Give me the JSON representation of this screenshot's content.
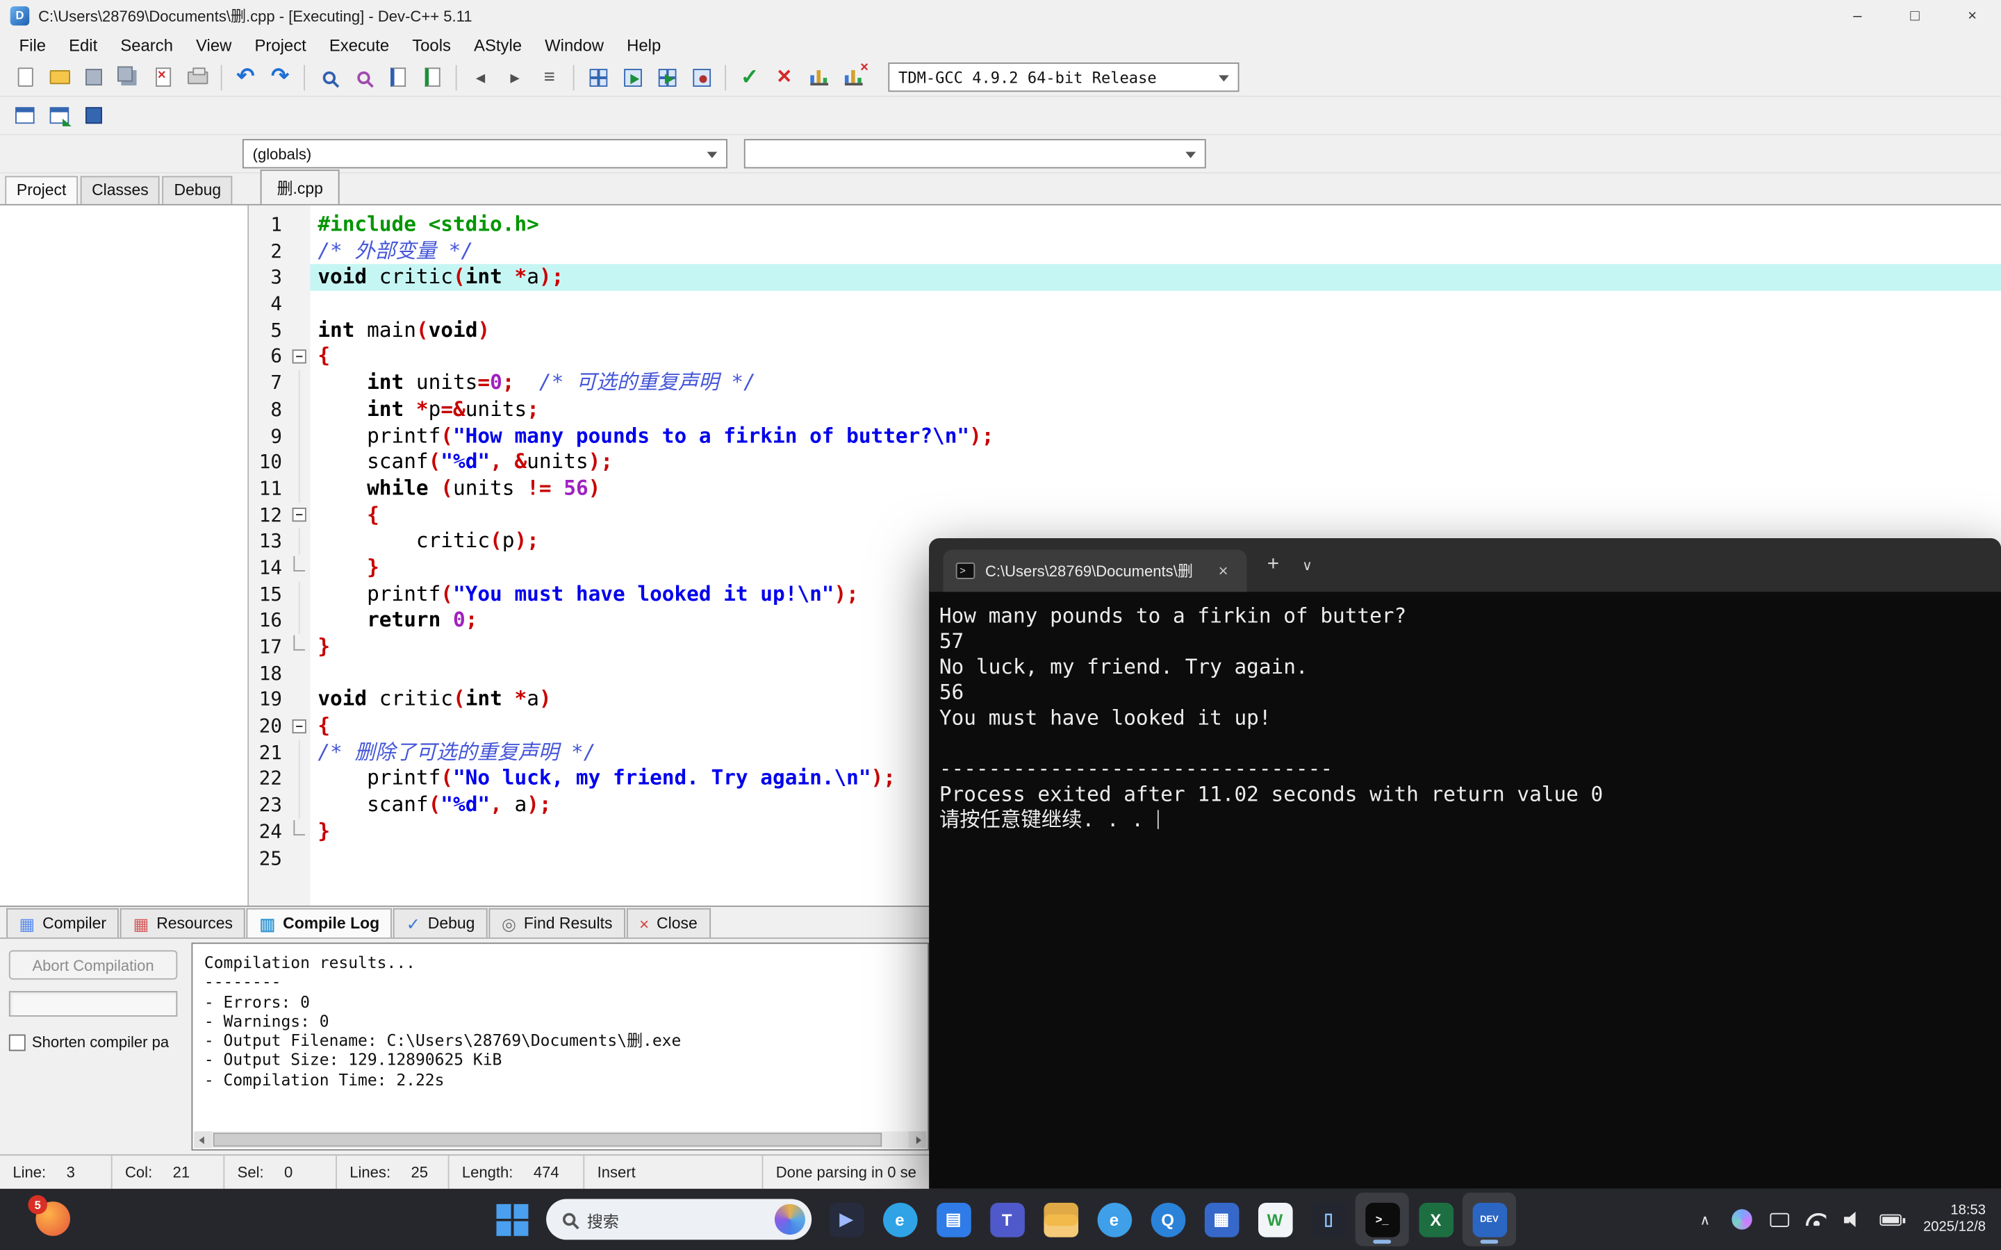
{
  "window": {
    "title": "C:\\Users\\28769\\Documents\\删.cpp - [Executing] - Dev-C++ 5.11",
    "controls": [
      {
        "name": "minimize",
        "glyph": "–"
      },
      {
        "name": "maximize",
        "glyph": "□"
      },
      {
        "name": "close",
        "glyph": "×"
      }
    ]
  },
  "menubar": [
    "File",
    "Edit",
    "Search",
    "View",
    "Project",
    "Execute",
    "Tools",
    "AStyle",
    "Window",
    "Help"
  ],
  "toolbar": {
    "compiler_select": "TDM-GCC 4.9.2 64-bit Release",
    "main": [
      {
        "name": "new-file",
        "k": "page"
      },
      {
        "name": "open-project",
        "k": "folder"
      },
      {
        "name": "save",
        "k": "floppy"
      },
      {
        "name": "save-all",
        "k": "floppy2"
      },
      {
        "name": "close-file",
        "k": "pagex"
      },
      {
        "name": "print",
        "k": "printer"
      },
      {
        "k": "sep"
      },
      {
        "name": "undo",
        "k": "undo"
      },
      {
        "name": "redo",
        "k": "redo"
      },
      {
        "k": "sep"
      },
      {
        "name": "find",
        "k": "mag"
      },
      {
        "name": "replace",
        "k": "magr"
      },
      {
        "name": "goto-line",
        "k": "pageb"
      },
      {
        "name": "incremental-search",
        "k": "pagebg"
      },
      {
        "k": "sep"
      },
      {
        "name": "back",
        "k": "arrl"
      },
      {
        "name": "forward",
        "k": "arrr"
      },
      {
        "name": "goto-function",
        "k": "list"
      },
      {
        "k": "sep"
      },
      {
        "name": "compile",
        "k": "grid4"
      },
      {
        "name": "run",
        "k": "grid1"
      },
      {
        "name": "compile-and-run",
        "k": "grid2"
      },
      {
        "name": "rebuild-all",
        "k": "grid3"
      },
      {
        "k": "sep"
      },
      {
        "name": "syntax-check",
        "k": "check"
      },
      {
        "name": "clean",
        "k": "cross"
      },
      {
        "name": "profile-analysis",
        "k": "chart"
      },
      {
        "name": "delete-profiling",
        "k": "chartx"
      }
    ],
    "specials": [
      {
        "name": "insert-snippet",
        "k": "win1"
      },
      {
        "name": "toggle-bookmark",
        "k": "win2"
      },
      {
        "name": "goto-bookmark",
        "k": "bluebox"
      }
    ]
  },
  "navigation": {
    "globals_select": "(globals)",
    "members_select": ""
  },
  "left_tabs": [
    "Project",
    "Classes",
    "Debug"
  ],
  "editor": {
    "tab": "删.cpp",
    "active_line": 3,
    "lines": [
      {
        "n": 1,
        "f": "",
        "t": [
          [
            "pre",
            "#include <stdio.h>"
          ]
        ]
      },
      {
        "n": 2,
        "f": "",
        "t": [
          [
            "com",
            "/* 外部变量 */"
          ]
        ]
      },
      {
        "n": 3,
        "f": "",
        "t": [
          [
            "kw",
            "void"
          ],
          [
            "pl",
            " critic"
          ],
          [
            "sym",
            "("
          ],
          [
            "kw",
            "int"
          ],
          [
            "pl",
            " "
          ],
          [
            "sym",
            "*"
          ],
          [
            "pl",
            "a"
          ],
          [
            "sym",
            ");"
          ]
        ]
      },
      {
        "n": 4,
        "f": "",
        "t": []
      },
      {
        "n": 5,
        "f": "",
        "t": [
          [
            "kw",
            "int"
          ],
          [
            "pl",
            " main"
          ],
          [
            "sym",
            "("
          ],
          [
            "kw",
            "void"
          ],
          [
            "sym",
            ")"
          ]
        ]
      },
      {
        "n": 6,
        "f": "minus",
        "t": [
          [
            "sym",
            "{"
          ]
        ]
      },
      {
        "n": 7,
        "f": "v",
        "t": [
          [
            "pl",
            "    "
          ],
          [
            "kw",
            "int"
          ],
          [
            "pl",
            " units"
          ],
          [
            "sym",
            "="
          ],
          [
            "num",
            "0"
          ],
          [
            "sym",
            ";"
          ],
          [
            "pl",
            "  "
          ],
          [
            "com",
            "/* 可选的重复声明 */"
          ]
        ]
      },
      {
        "n": 8,
        "f": "v",
        "t": [
          [
            "pl",
            "    "
          ],
          [
            "kw",
            "int"
          ],
          [
            "pl",
            " "
          ],
          [
            "sym",
            "*"
          ],
          [
            "pl",
            "p"
          ],
          [
            "sym",
            "=&"
          ],
          [
            "pl",
            "units"
          ],
          [
            "sym",
            ";"
          ]
        ]
      },
      {
        "n": 9,
        "f": "v",
        "t": [
          [
            "pl",
            "    printf"
          ],
          [
            "sym",
            "("
          ],
          [
            "str",
            "\"How many pounds to a firkin of butter?\\n\""
          ],
          [
            "sym",
            ");"
          ]
        ]
      },
      {
        "n": 10,
        "f": "v",
        "t": [
          [
            "pl",
            "    scanf"
          ],
          [
            "sym",
            "("
          ],
          [
            "str",
            "\"%d\""
          ],
          [
            "sym",
            ", &"
          ],
          [
            "pl",
            "units"
          ],
          [
            "sym",
            ");"
          ]
        ]
      },
      {
        "n": 11,
        "f": "v",
        "t": [
          [
            "pl",
            "    "
          ],
          [
            "kw",
            "while"
          ],
          [
            "pl",
            " "
          ],
          [
            "sym",
            "("
          ],
          [
            "pl",
            "units "
          ],
          [
            "sym",
            "!="
          ],
          [
            "pl",
            " "
          ],
          [
            "num",
            "56"
          ],
          [
            "sym",
            ")"
          ]
        ]
      },
      {
        "n": 12,
        "f": "minus",
        "t": [
          [
            "pl",
            "    "
          ],
          [
            "sym",
            "{"
          ]
        ]
      },
      {
        "n": 13,
        "f": "v",
        "t": [
          [
            "pl",
            "        critic"
          ],
          [
            "sym",
            "("
          ],
          [
            "pl",
            "p"
          ],
          [
            "sym",
            ");"
          ]
        ]
      },
      {
        "n": 14,
        "f": "end",
        "t": [
          [
            "pl",
            "    "
          ],
          [
            "sym",
            "}"
          ]
        ]
      },
      {
        "n": 15,
        "f": "v",
        "t": [
          [
            "pl",
            "    printf"
          ],
          [
            "sym",
            "("
          ],
          [
            "str",
            "\"You must have looked it up!\\n\""
          ],
          [
            "sym",
            ");"
          ]
        ]
      },
      {
        "n": 16,
        "f": "v",
        "t": [
          [
            "pl",
            "    "
          ],
          [
            "kw",
            "return"
          ],
          [
            "pl",
            " "
          ],
          [
            "num",
            "0"
          ],
          [
            "sym",
            ";"
          ]
        ]
      },
      {
        "n": 17,
        "f": "end",
        "t": [
          [
            "sym",
            "}"
          ]
        ]
      },
      {
        "n": 18,
        "f": "",
        "t": []
      },
      {
        "n": 19,
        "f": "",
        "t": [
          [
            "kw",
            "void"
          ],
          [
            "pl",
            " critic"
          ],
          [
            "sym",
            "("
          ],
          [
            "kw",
            "int"
          ],
          [
            "pl",
            " "
          ],
          [
            "sym",
            "*"
          ],
          [
            "pl",
            "a"
          ],
          [
            "sym",
            ")"
          ]
        ]
      },
      {
        "n": 20,
        "f": "minus",
        "t": [
          [
            "sym",
            "{"
          ]
        ]
      },
      {
        "n": 21,
        "f": "v",
        "t": [
          [
            "com",
            "/* 删除了可选的重复声明 */"
          ]
        ]
      },
      {
        "n": 22,
        "f": "v",
        "t": [
          [
            "pl",
            "    printf"
          ],
          [
            "sym",
            "("
          ],
          [
            "str",
            "\"No luck, my friend. Try again.\\n\""
          ],
          [
            "sym",
            ");"
          ]
        ]
      },
      {
        "n": 23,
        "f": "v",
        "t": [
          [
            "pl",
            "    scanf"
          ],
          [
            "sym",
            "("
          ],
          [
            "str",
            "\"%d\""
          ],
          [
            "sym",
            ", "
          ],
          [
            "pl",
            "a"
          ],
          [
            "sym",
            ");"
          ]
        ]
      },
      {
        "n": 24,
        "f": "end",
        "t": [
          [
            "sym",
            "}"
          ]
        ]
      },
      {
        "n": 25,
        "f": "",
        "t": []
      }
    ]
  },
  "bottom": {
    "tabs": [
      {
        "label": "Compiler",
        "glyph": "▦",
        "color": "#5b8def",
        "active": false
      },
      {
        "label": "Resources",
        "glyph": "▦",
        "color": "#d45b5b",
        "active": false
      },
      {
        "label": "Compile Log",
        "glyph": "▥",
        "color": "#3a9ad4",
        "active": true
      },
      {
        "label": "Debug",
        "glyph": "✓",
        "color": "#3a78d4",
        "active": false
      },
      {
        "label": "Find Results",
        "glyph": "◎",
        "color": "#707070",
        "active": false
      },
      {
        "label": "Close",
        "glyph": "×",
        "color": "#d43b3b",
        "active": false
      }
    ],
    "abort_label": "Abort Compilation",
    "shorten_label": "Shorten compiler pa",
    "log_lines": [
      "Compilation results...",
      "--------",
      "- Errors: 0",
      "- Warnings: 0",
      "- Output Filename: C:\\Users\\28769\\Documents\\删.exe",
      "- Output Size: 129.12890625 KiB",
      "- Compilation Time: 2.22s"
    ]
  },
  "statusbar": [
    {
      "label": "Line:",
      "value": "3"
    },
    {
      "label": "Col:",
      "value": "21"
    },
    {
      "label": "Sel:",
      "value": "0"
    },
    {
      "label": "Lines:",
      "value": "25"
    },
    {
      "label": "Length:",
      "value": "474"
    },
    {
      "label": "Insert",
      "value": ""
    },
    {
      "label": "Done parsing in 0 se",
      "value": ""
    }
  ],
  "console": {
    "tab_title": "C:\\Users\\28769\\Documents\\删",
    "close_glyph": "×",
    "new_tab_glyph": "+",
    "menu_glyph": "∨",
    "lines": [
      "How many pounds to a firkin of butter?",
      "57",
      "No luck, my friend. Try again.",
      "56",
      "You must have looked it up!",
      "",
      "--------------------------------",
      "Process exited after 11.02 seconds with return value 0",
      "请按任意键继续. . . "
    ]
  },
  "taskbar": {
    "badge_count": "5",
    "search_placeholder": "搜索",
    "tray_chevron": "∧",
    "apps": [
      {
        "name": "media-app",
        "shape": "square",
        "bg": "#262b3d",
        "fg": "#9db8ff",
        "glyph": "▶",
        "active": false
      },
      {
        "name": "edge",
        "shape": "circle",
        "bg": "#2fa3e6",
        "fg": "#ffffff",
        "glyph": "e",
        "active": false
      },
      {
        "name": "microsoft-store",
        "shape": "square",
        "bg": "#2f7ce8",
        "fg": "#ffffff",
        "glyph": "▤",
        "active": false
      },
      {
        "name": "teams",
        "shape": "square",
        "bg": "#5059c9",
        "fg": "#ffffff",
        "glyph": "T",
        "active": false
      },
      {
        "name": "file-explorer",
        "shape": "folder",
        "bg": "#f2b94b",
        "fg": "#a87f1d",
        "glyph": "",
        "active": false
      },
      {
        "name": "browser",
        "shape": "circle",
        "bg": "#3f9fe8",
        "fg": "#ffffff",
        "glyph": "e",
        "active": false
      },
      {
        "name": "qq",
        "shape": "circle",
        "bg": "#2b82d9",
        "fg": "#ffffff",
        "glyph": "Q",
        "active": false
      },
      {
        "name": "dev-tool",
        "shape": "square",
        "bg": "#3668c9",
        "fg": "#ffffff",
        "glyph": "▦",
        "active": false
      },
      {
        "name": "wechat",
        "shape": "square",
        "bg": "#f2f5f7",
        "fg": "#2f9e44",
        "glyph": "W",
        "active": false
      },
      {
        "name": "phone-link",
        "shape": "square",
        "bg": "#23262e",
        "fg": "#8fc7ff",
        "glyph": "▯",
        "active": false
      },
      {
        "name": "terminal",
        "shape": "square",
        "bg": "#0c0c0c",
        "fg": "#ffffff",
        "glyph": ">_",
        "active": true
      },
      {
        "name": "excel",
        "shape": "square",
        "bg": "#1d6f42",
        "fg": "#ffffff",
        "glyph": "X",
        "active": false
      },
      {
        "name": "dev-cpp",
        "shape": "square",
        "bg": "#2b66c2",
        "fg": "#ffffff",
        "glyph": "DEV",
        "active": true
      }
    ],
    "clock": {
      "time": "18:53",
      "date": "2025/12/8"
    }
  }
}
